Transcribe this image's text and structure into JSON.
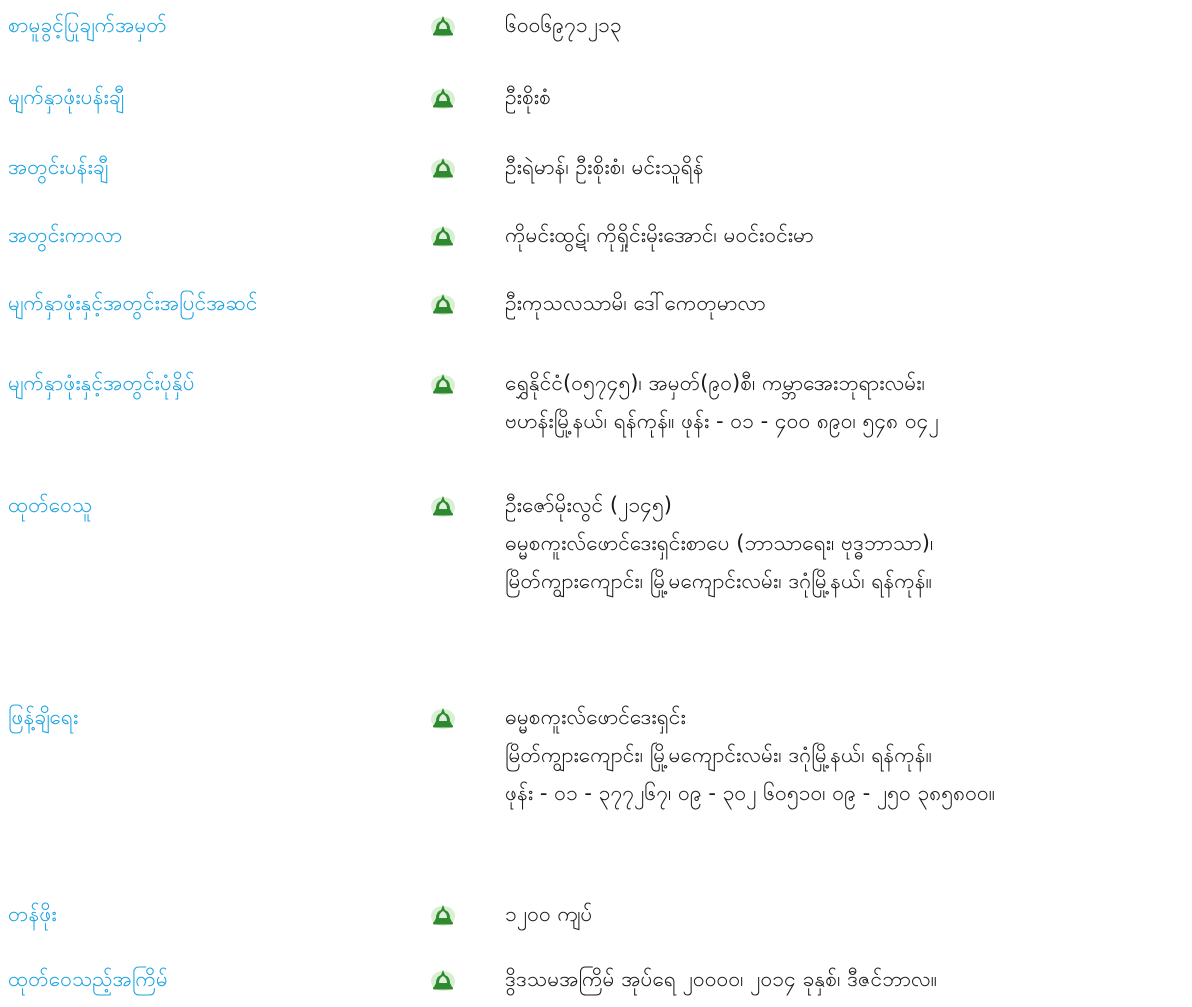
{
  "colors": {
    "label": "#1aa4e3",
    "text": "#1a1a1a",
    "icon_green": "#2f8a2f",
    "icon_glow": "#d8efd4"
  },
  "bullet_icon": "stupa-emblem-icon",
  "rows": [
    {
      "label": "စာမူခွင့်ပြုချက်အမှတ်",
      "lines": [
        "၆၀၀၆၉၇၁၂၁၃"
      ]
    },
    {
      "label": "မျက်နှာဖုံးပန်းချီ",
      "lines": [
        "ဦးစိုးစံ"
      ]
    },
    {
      "label": "အတွင်းပန်းချီ",
      "lines": [
        "ဦးရဲမာန်၊ ဦးစိုးစံ၊ မင်းသူရိန်"
      ]
    },
    {
      "label": "အတွင်းကာလာ",
      "lines": [
        "ကိုမင်းထွဋ်၊ ကိုရှိုင်းမိုးအောင်၊ မဝင်းဝင်းမာ"
      ]
    },
    {
      "label": "မျက်နှာဖုံးနှင့်အတွင်းအပြင်အဆင်",
      "lines": [
        "ဦးကုသလသာမိ၊ ဒေါ်ကေတုမာလာ"
      ]
    },
    {
      "label": "မျက်နှာဖုံးနှင့်အတွင်းပုံနှိပ်",
      "lines": [
        "ရွှေနိုင်ငံ(၀၅၇၄၅)၊ အမှတ်(၉၀)စီ၊ ကမ္ဘာအေးဘုရားလမ်း၊",
        "ဗဟန်းမြို့နယ်၊ ရန်ကုန်။ ဖုန်း - ၀၁ - ၄၀၀ ၈၉၀၊ ၅၄၈ ၀၄၂"
      ]
    },
    {
      "label": "ထုတ်ဝေသူ",
      "lines": [
        "ဦးဇော်မိုးလွင် (၂၁၄၅)",
        "ဓမ္မစကူးလ်ဖောင်ဒေးရှင်းစာပေ (ဘာသာရေး၊ ဗုဒ္ဓဘာသာ)၊",
        "မြိတ်ကျွားကျောင်း၊ မြို့မကျောင်းလမ်း၊ ဒဂုံမြို့နယ်၊ ရန်ကုန်။"
      ]
    },
    {
      "label": "ဖြန့်ချိရေး",
      "lines": [
        "ဓမ္မစကူးလ်ဖောင်ဒေးရှင်း",
        "မြိတ်ကျွားကျောင်း၊ မြို့မကျောင်းလမ်း၊ ဒဂုံမြို့နယ်၊ ရန်ကုန်။",
        "ဖုန်း - ၀၁ - ၃၇၇၂၆၇၊ ၀၉ - ၃၀၂ ၆၀၅၁၀၊ ၀၉ - ၂၅၀ ၃၈၅၈၀၀။"
      ]
    },
    {
      "label": "တန်ဖိုး",
      "lines": [
        "၁၂၀၀ ကျပ်"
      ]
    },
    {
      "label": "ထုတ်ဝေသည့်အကြိမ်",
      "lines": [
        "ဒွိဒသမအကြိမ်    အုပ်ရေ ၂၀၀၀၀၊ ၂၀၁၄ ခုနှစ်၊ ဒီဇင်ဘာလ။"
      ]
    }
  ]
}
